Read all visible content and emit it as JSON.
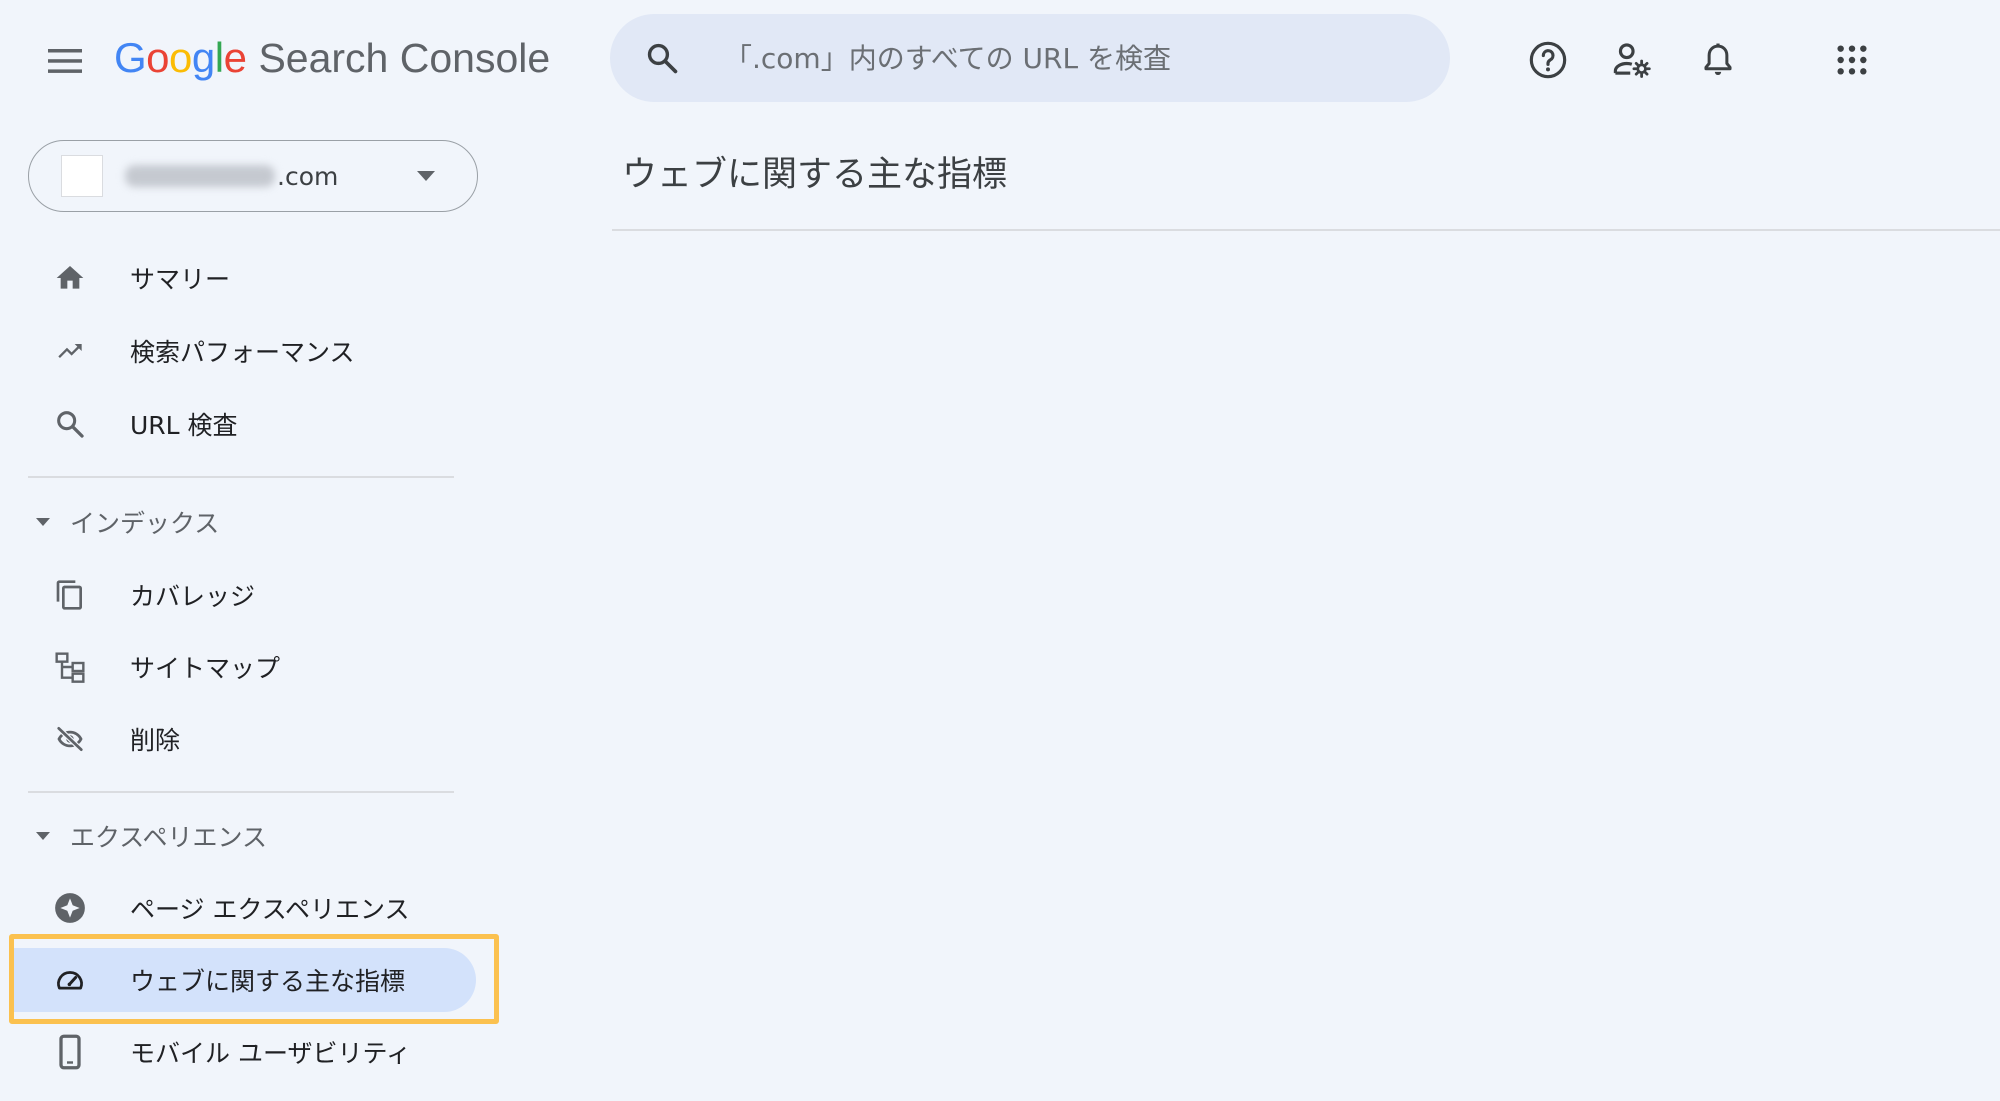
{
  "header": {
    "menu_icon": "menu-icon",
    "logo": {
      "letters": [
        {
          "ch": "G",
          "color": "#4285F4"
        },
        {
          "ch": "o",
          "color": "#EA4335"
        },
        {
          "ch": "o",
          "color": "#FBBC05"
        },
        {
          "ch": "g",
          "color": "#4285F4"
        },
        {
          "ch": "l",
          "color": "#34A853"
        },
        {
          "ch": "e",
          "color": "#EA4335"
        }
      ],
      "product": "Search Console"
    },
    "search": {
      "placeholder": "「.com」内のすべての URL を検査"
    },
    "icons": [
      "help-icon",
      "manage-users-icon",
      "notifications-icon",
      "apps-icon"
    ]
  },
  "sidebar": {
    "property": {
      "domain": ".com"
    },
    "items_top": [
      {
        "label": "サマリー",
        "icon": "home-icon"
      },
      {
        "label": "検索パフォーマンス",
        "icon": "trending-up-icon"
      },
      {
        "label": "URL 検査",
        "icon": "search-icon"
      }
    ],
    "section_index": {
      "title": "インデックス",
      "items": [
        {
          "label": "カバレッジ",
          "icon": "copy-icon"
        },
        {
          "label": "サイトマップ",
          "icon": "sitemap-icon"
        },
        {
          "label": "削除",
          "icon": "visibility-off-icon"
        }
      ]
    },
    "section_experience": {
      "title": "エクスペリエンス",
      "items": [
        {
          "label": "ページ エクスペリエンス",
          "icon": "page-experience-icon"
        },
        {
          "label": "ウェブに関する主な指標",
          "icon": "speed-icon",
          "active": true
        },
        {
          "label": "モバイル ユーザビリティ",
          "icon": "phone-icon"
        }
      ]
    }
  },
  "main": {
    "title": "ウェブに関する主な指標"
  },
  "colors": {
    "background": "#f1f5fb",
    "search_bg": "#e1e8f6",
    "active_bg": "#d3e2fb",
    "highlight": "#fbc14f"
  }
}
